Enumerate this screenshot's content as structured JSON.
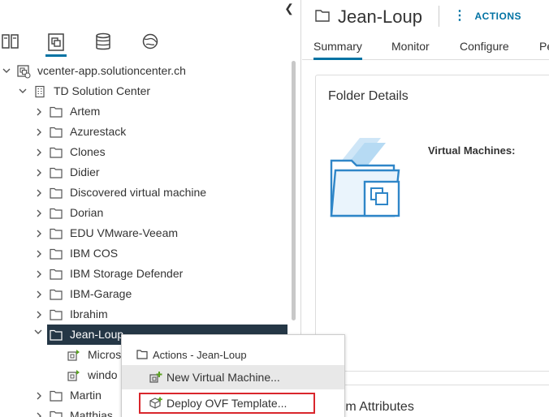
{
  "nav": {
    "collapse_icon": "chevron-left-icon",
    "tabs": [
      {
        "name": "hosts-clusters",
        "icon": "hosts-icon",
        "active": false
      },
      {
        "name": "vms-templates",
        "icon": "vms-templates-icon",
        "active": true
      },
      {
        "name": "storage",
        "icon": "database-icon",
        "active": false
      },
      {
        "name": "networking",
        "icon": "globe-icon",
        "active": false
      }
    ],
    "tree": [
      {
        "label": "vcenter-app.solutioncenter.ch",
        "level": 0,
        "icon": "vcenter-icon",
        "chevron": "down"
      },
      {
        "label": "TD Solution Center",
        "level": 1,
        "icon": "datacenter-icon",
        "chevron": "down"
      },
      {
        "label": "Artem",
        "level": 2,
        "icon": "folder-icon",
        "chevron": "right"
      },
      {
        "label": "Azurestack",
        "level": 2,
        "icon": "folder-icon",
        "chevron": "right"
      },
      {
        "label": "Clones",
        "level": 2,
        "icon": "folder-icon",
        "chevron": "right"
      },
      {
        "label": "Didier",
        "level": 2,
        "icon": "folder-icon",
        "chevron": "right"
      },
      {
        "label": "Discovered virtual machine",
        "level": 2,
        "icon": "folder-icon",
        "chevron": "right"
      },
      {
        "label": "Dorian",
        "level": 2,
        "icon": "folder-icon",
        "chevron": "right"
      },
      {
        "label": "EDU VMware-Veeam",
        "level": 2,
        "icon": "folder-icon",
        "chevron": "right"
      },
      {
        "label": "IBM COS",
        "level": 2,
        "icon": "folder-icon",
        "chevron": "right"
      },
      {
        "label": "IBM Storage Defender",
        "level": 2,
        "icon": "folder-icon",
        "chevron": "right"
      },
      {
        "label": "IBM-Garage",
        "level": 2,
        "icon": "folder-icon",
        "chevron": "right"
      },
      {
        "label": "Ibrahim",
        "level": 2,
        "icon": "folder-icon",
        "chevron": "right"
      },
      {
        "label": "Jean-Loup",
        "level": 2,
        "icon": "folder-icon",
        "chevron": "down",
        "selected": true
      },
      {
        "label": "Micros",
        "level": 3,
        "icon": "vm-icon",
        "chevron": ""
      },
      {
        "label": "windo",
        "level": 3,
        "icon": "vm-icon",
        "chevron": ""
      },
      {
        "label": "Martin",
        "level": 2,
        "icon": "folder-icon",
        "chevron": "right"
      },
      {
        "label": "Matthias",
        "level": 2,
        "icon": "folder-icon",
        "chevron": "right"
      }
    ]
  },
  "main": {
    "title": "Jean-Loup",
    "title_icon": "folder-icon",
    "actions_label": "ACTIONS",
    "tabs": [
      {
        "label": "Summary",
        "active": true
      },
      {
        "label": "Monitor",
        "active": false
      },
      {
        "label": "Configure",
        "active": false
      },
      {
        "label": "Pe",
        "active": false
      }
    ],
    "folder_details": {
      "title": "Folder Details",
      "vm_label": "Virtual Machines:",
      "illustration": "folder-vms-illustration"
    },
    "custom_attributes": {
      "title": "stom Attributes"
    }
  },
  "context_menu": {
    "header": "Actions - Jean-Loup",
    "header_icon": "folder-icon",
    "items": [
      {
        "label": "New Virtual Machine...",
        "icon": "new-vm-icon",
        "hovered": true
      },
      {
        "label": "Deploy OVF Template...",
        "icon": "deploy-ovf-icon",
        "highlighted": true
      }
    ]
  },
  "colors": {
    "accent": "#0072a3",
    "selected_row": "#253746",
    "highlight_outline": "#d9262c",
    "vm_green": "#5aa220"
  }
}
